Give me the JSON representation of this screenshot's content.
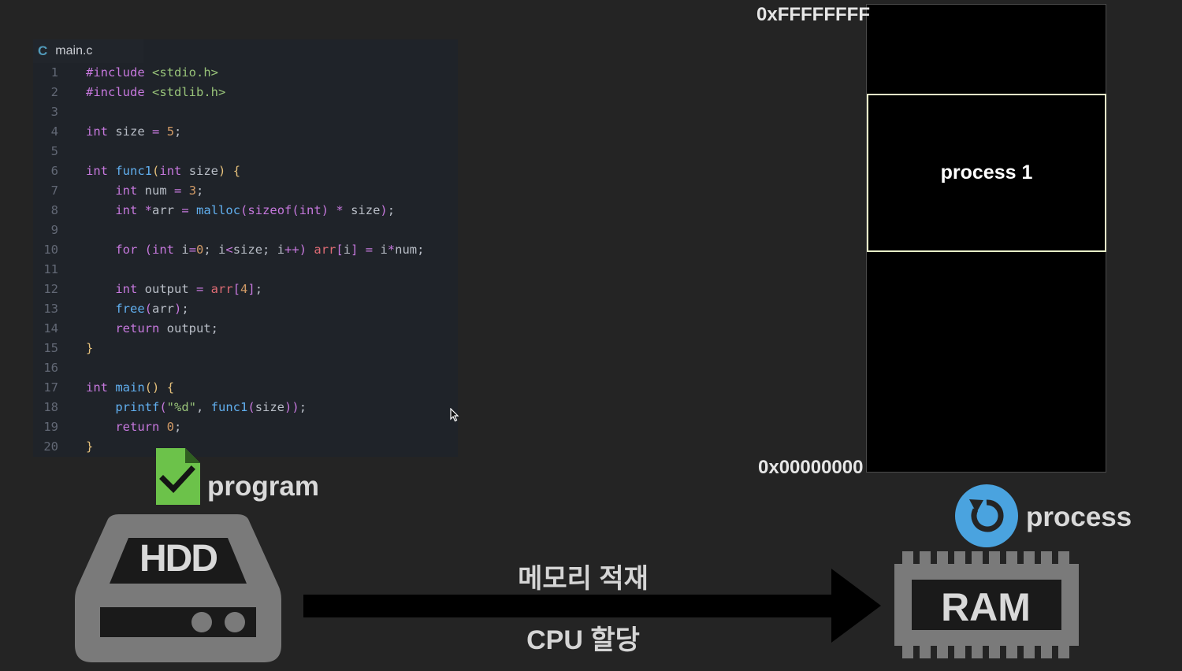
{
  "editor": {
    "tab_lang": "C",
    "filename": "main.c",
    "lines": [
      {
        "n": "1",
        "html": "<span class='k'>#include</span> <span class='s'>&lt;stdio.h&gt;</span>"
      },
      {
        "n": "2",
        "html": "<span class='k'>#include</span> <span class='s'>&lt;stdlib.h&gt;</span>"
      },
      {
        "n": "3",
        "html": ""
      },
      {
        "n": "4",
        "html": "<span class='k'>int</span> size <span class='p'>=</span> <span class='n'>5</span>;"
      },
      {
        "n": "5",
        "html": ""
      },
      {
        "n": "6",
        "html": "<span class='k'>int</span> <span class='f'>func1</span><span class='br'>(</span><span class='k'>int</span> size<span class='br'>)</span> <span class='br'>{</span>"
      },
      {
        "n": "7",
        "html": "    <span class='k'>int</span> num <span class='p'>=</span> <span class='n'>3</span>;"
      },
      {
        "n": "8",
        "html": "    <span class='k'>int</span> <span class='p'>*</span>arr <span class='p'>=</span> <span class='f'>malloc</span><span class='p'>(</span><span class='k'>sizeof</span><span class='p'>(</span><span class='k'>int</span><span class='p'>)</span> <span class='p'>*</span> size<span class='p'>)</span>;"
      },
      {
        "n": "9",
        "html": ""
      },
      {
        "n": "10",
        "html": "    <span class='k'>for</span> <span class='p'>(</span><span class='k'>int</span> i<span class='p'>=</span><span class='n'>0</span>; i<span class='p'>&lt;</span>size; i<span class='p'>++)</span> <span class='r'>arr</span><span class='p'>[</span>i<span class='p'>]</span> <span class='p'>=</span> i<span class='p'>*</span>num;"
      },
      {
        "n": "11",
        "html": ""
      },
      {
        "n": "12",
        "html": "    <span class='k'>int</span> output <span class='p'>=</span> <span class='r'>arr</span><span class='p'>[</span><span class='n'>4</span><span class='p'>]</span>;"
      },
      {
        "n": "13",
        "html": "    <span class='f'>free</span><span class='p'>(</span>arr<span class='p'>)</span>;"
      },
      {
        "n": "14",
        "html": "    <span class='k'>return</span> output;"
      },
      {
        "n": "15",
        "html": "<span class='br'>}</span>"
      },
      {
        "n": "16",
        "html": ""
      },
      {
        "n": "17",
        "html": "<span class='k'>int</span> <span class='f'>main</span><span class='br'>()</span> <span class='br'>{</span>"
      },
      {
        "n": "18",
        "html": "    <span class='f'>printf</span><span class='p'>(</span><span class='s'>\"%d\"</span>, <span class='f'>func1</span><span class='p'>(</span>size<span class='p'>))</span>;"
      },
      {
        "n": "19",
        "html": "    <span class='k'>return</span> <span class='n'>0</span>;"
      },
      {
        "n": "20",
        "html": "<span class='br'>}</span>"
      }
    ]
  },
  "program": {
    "label": "program"
  },
  "hdd": {
    "label": "HDD"
  },
  "arrow": {
    "top_label": "메모리 적재",
    "bottom_label": "CPU 할당"
  },
  "memory": {
    "addr_top": "0xFFFFFFFF",
    "addr_bottom": "0x00000000",
    "process_block_label": "process 1"
  },
  "process": {
    "label": "process"
  },
  "ram": {
    "label": "RAM"
  },
  "colors": {
    "accent_green": "#6cc24a",
    "process_blue": "#4aa3df",
    "icon_gray": "#7a7a7a"
  }
}
